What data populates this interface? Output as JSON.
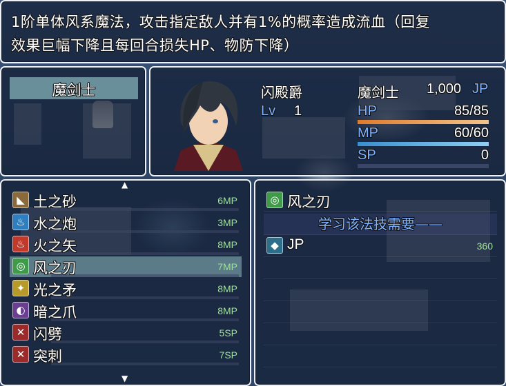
{
  "help": {
    "line1": "1阶单体风系魔法，攻击指定敌人并有1%的概率造成流血（回复",
    "line2": "效果巨幅下降且每回合损失HP、物防下降）"
  },
  "class_window": {
    "selected": "魔剑士"
  },
  "status": {
    "actor_name": "闪殿爵",
    "class_name": "魔剑士",
    "jp_value": "1,000",
    "jp_unit": "JP",
    "level_label": "Lv",
    "level": "1",
    "hp_label": "HP",
    "hp": "85/85",
    "hp_fill": 1.0,
    "mp_label": "MP",
    "mp": "60/60",
    "mp_fill": 1.0,
    "sp_label": "SP",
    "sp": "0",
    "sp_fill": 0.0,
    "colors": {
      "hp": "#e08a3c",
      "mp": "#4aa2d8",
      "sp": "#3a4b7a",
      "system": "#7fb2ff"
    }
  },
  "skills": [
    {
      "icon": "earth-icon",
      "glyph": "◣",
      "name": "土之砂",
      "cost": "6MP",
      "selected": false,
      "color": "#8a6a3a"
    },
    {
      "icon": "water-icon",
      "glyph": "♨",
      "name": "水之炮",
      "cost": "3MP",
      "selected": false,
      "color": "#2f7fc0"
    },
    {
      "icon": "fire-icon",
      "glyph": "♨",
      "name": "火之矢",
      "cost": "8MP",
      "selected": false,
      "color": "#c0392b"
    },
    {
      "icon": "wind-icon",
      "glyph": "◎",
      "name": "风之刃",
      "cost": "7MP",
      "selected": true,
      "color": "#3f9b4a"
    },
    {
      "icon": "light-icon",
      "glyph": "✦",
      "name": "光之矛",
      "cost": "8MP",
      "selected": false,
      "color": "#b79b2a"
    },
    {
      "icon": "dark-icon",
      "glyph": "◐",
      "name": "暗之爪",
      "cost": "8MP",
      "selected": false,
      "color": "#6a3f8f"
    },
    {
      "icon": "flash-strike-icon",
      "glyph": "✕",
      "name": "闪劈",
      "cost": "5SP",
      "selected": false,
      "color": "#9b2b2b"
    },
    {
      "icon": "thrust-icon",
      "glyph": "✕",
      "name": "突刺",
      "cost": "7SP",
      "selected": false,
      "color": "#9b2b2b"
    }
  ],
  "learn": {
    "skill_icon": "wind-icon",
    "skill_name": "风之刃",
    "requirement_title": "学习该法技需要——",
    "cost_icon": "jp-crystal-icon",
    "cost_label": "JP",
    "cost_value": "360"
  }
}
